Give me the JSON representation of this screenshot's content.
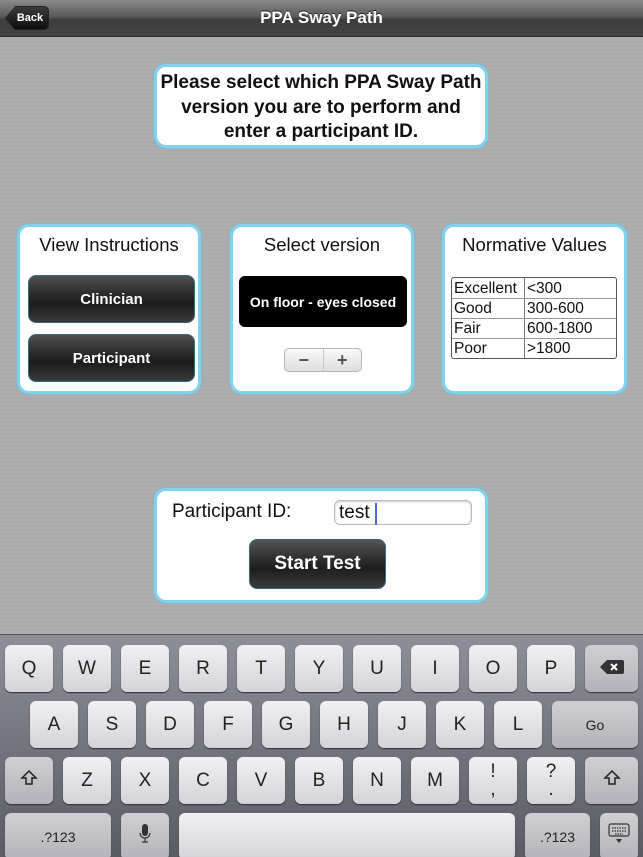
{
  "navbar": {
    "title": "PPA Sway Path",
    "back_label": "Back"
  },
  "prompt": {
    "text": "Please select which PPA Sway Path version you are to perform and enter a participant ID."
  },
  "instructions": {
    "title": "View Instructions",
    "buttons": [
      "Clinician",
      "Participant"
    ]
  },
  "version": {
    "title": "Select version",
    "selected": "On floor - eyes closed",
    "decrement_label": "−",
    "increment_label": "+"
  },
  "normative": {
    "title": "Normative Values",
    "rows": [
      {
        "label": "Excellent",
        "range": "<300"
      },
      {
        "label": "Good",
        "range": "300-600"
      },
      {
        "label": "Fair",
        "range": "600-1800"
      },
      {
        "label": "Poor",
        "range": ">1800"
      }
    ]
  },
  "participant": {
    "label": "Participant ID:",
    "value": "test",
    "start_label": "Start Test"
  },
  "keyboard": {
    "row1": [
      "Q",
      "W",
      "E",
      "R",
      "T",
      "Y",
      "U",
      "I",
      "O",
      "P"
    ],
    "row2": [
      "A",
      "S",
      "D",
      "F",
      "G",
      "H",
      "J",
      "K",
      "L"
    ],
    "go_label": "Go",
    "row3": [
      "Z",
      "X",
      "C",
      "V",
      "B",
      "N",
      "M"
    ],
    "punct1": {
      "top": "!",
      "bottom": ","
    },
    "punct2": {
      "top": "?",
      "bottom": "."
    },
    "numbers_label": ".?123",
    "backspace_icon": "backspace-icon",
    "shift_icon": "shift-icon",
    "mic_icon": "microphone-icon",
    "hide_icon": "keyboard-hide-icon"
  }
}
